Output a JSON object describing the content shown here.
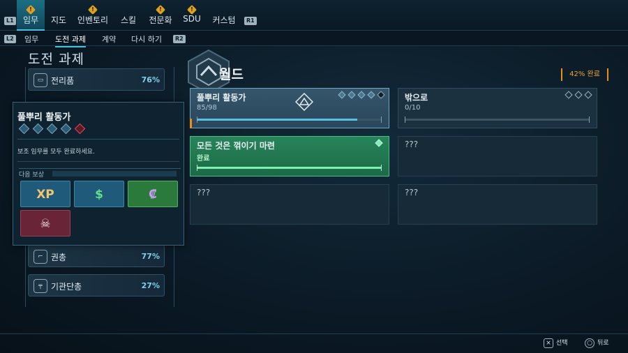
{
  "top_nav": {
    "left_bumper": "L1",
    "right_bumper": "R1",
    "tabs": [
      {
        "label": "임무",
        "active": true,
        "alert": "!"
      },
      {
        "label": "지도",
        "active": false
      },
      {
        "label": "인벤토리",
        "active": false,
        "alert": "!"
      },
      {
        "label": "스킬",
        "active": false
      },
      {
        "label": "전문화",
        "active": false,
        "alert": "!"
      },
      {
        "label": "SDU",
        "active": false,
        "alert": "!"
      },
      {
        "label": "커스텀",
        "active": false
      }
    ]
  },
  "sub_nav": {
    "left_bumper": "L2",
    "right_bumper": "R2",
    "tabs": [
      {
        "label": "임무",
        "active": false
      },
      {
        "label": "도전 과제",
        "active": true
      },
      {
        "label": "계약",
        "active": false
      },
      {
        "label": "다시 하기",
        "active": false
      }
    ]
  },
  "page_title": "도전 과제",
  "categories": [
    {
      "name": "전리품",
      "percent": "76%",
      "icon": "loot-icon"
    },
    {
      "name": "권총",
      "percent": "77%",
      "icon": "pistol-icon"
    },
    {
      "name": "기관단총",
      "percent": "27%",
      "icon": "smg-icon"
    }
  ],
  "popup": {
    "title": "풀뿌리 활동가",
    "rank_total": 5,
    "rank_current": 5,
    "description": "보조 임무를 모두 완료하세요.",
    "reward_header": "다음 보상",
    "rewards": [
      {
        "icon": "xp-icon",
        "glyph": "XP",
        "color": "#1f5a7a"
      },
      {
        "icon": "cash-icon",
        "glyph": "$",
        "color": "#1f5a7a"
      },
      {
        "icon": "ecredit-icon",
        "glyph": "₡",
        "color": "#2a7a3c"
      },
      {
        "icon": "skull-icon",
        "glyph": "☠",
        "color": "#6a2438"
      }
    ]
  },
  "section": {
    "title": "월드",
    "completion": "42% 완료"
  },
  "challenges": [
    {
      "title": "풀뿌리 활동가",
      "progress_text": "85/98",
      "progress": 0.867,
      "state": "selected",
      "ranks_filled": 4,
      "ranks_total": 5
    },
    {
      "title": "밖으로",
      "progress_text": "0/10",
      "progress": 0,
      "state": "normal",
      "ranks_filled": 0,
      "ranks_total": 3
    },
    {
      "title": "모든 것은 꺾이기 마련",
      "progress_text": "완료",
      "progress": 1,
      "state": "complete",
      "ranks_filled": 1,
      "ranks_total": 1
    },
    {
      "title": "???",
      "progress_text": "",
      "progress": 0,
      "state": "locked"
    },
    {
      "title": "???",
      "progress_text": "",
      "progress": 0,
      "state": "locked"
    },
    {
      "title": "???",
      "progress_text": "",
      "progress": 0,
      "state": "locked"
    }
  ],
  "hints": [
    {
      "key": "×",
      "label": "선택"
    },
    {
      "key": "○",
      "label": "뒤로"
    }
  ],
  "colors": {
    "accent": "#47c0dc",
    "complete": "#27845a",
    "completion_text": "#f0a23a",
    "alert": "#e0a11b"
  }
}
